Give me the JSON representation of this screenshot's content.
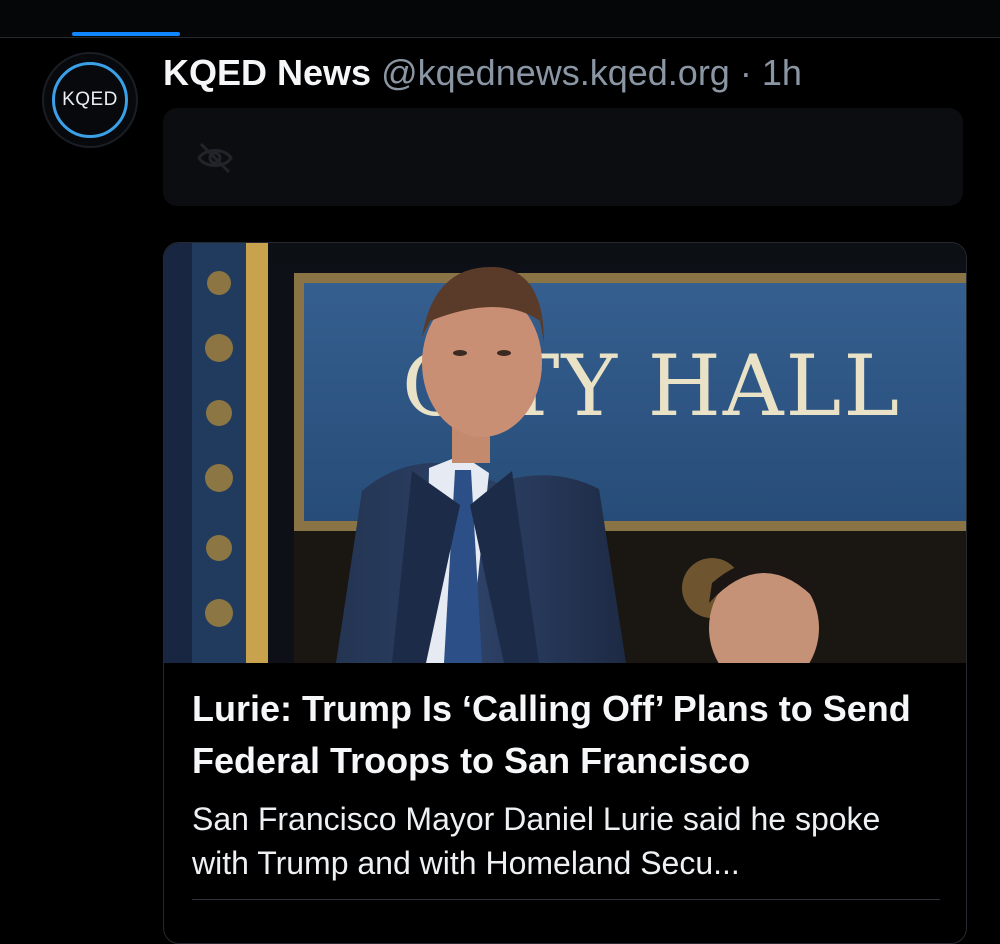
{
  "header": {
    "author_name": "KQED News",
    "handle": "@kqednews.kqed.org",
    "separator": "·",
    "time": "1h"
  },
  "avatar": {
    "text": "KQED"
  },
  "colors": {
    "accent": "#1186ff",
    "background": "#000000",
    "muted_text": "#8a96a4"
  },
  "warning": {
    "icon": "eye-slash-icon"
  },
  "card": {
    "sign_text": "CITY HALL",
    "title": "Lurie: Trump Is ‘Calling Off’ Plans to Send Federal Troops to San Francisco",
    "description": "San Francisco Mayor Daniel Lurie said he spoke with Trump and with Homeland Secu..."
  }
}
